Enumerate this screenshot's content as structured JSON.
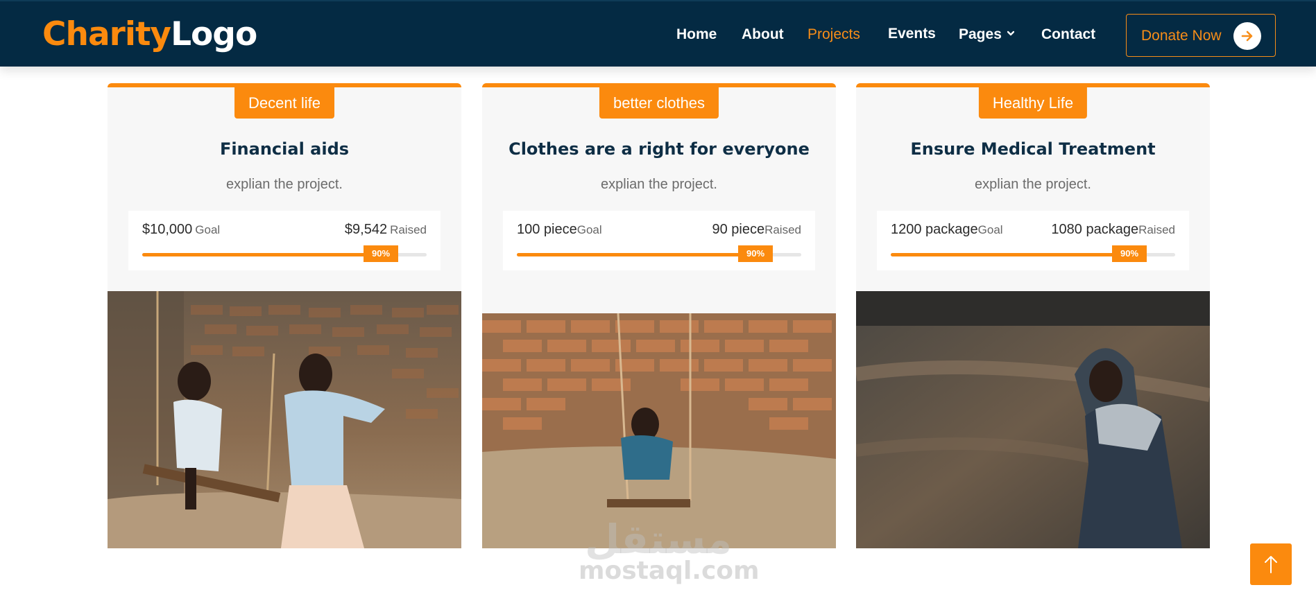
{
  "nav": {
    "logo_part1": "Charity",
    "logo_part2": "Logo",
    "links": [
      {
        "label": "Home"
      },
      {
        "label": "About"
      },
      {
        "label": "Projects"
      },
      {
        "label": "Events"
      },
      {
        "label": "Pages"
      },
      {
        "label": "Contact"
      }
    ],
    "active_link": "Projects",
    "donate_label": "Donate Now"
  },
  "colors": {
    "accent": "#fb8a0e",
    "navbar": "#042a43",
    "title": "#0e2e45",
    "card_bg": "#f7f7f7"
  },
  "projects": [
    {
      "badge": "Decent life",
      "title": "Financial aids",
      "description": "explian the project.",
      "goal_value": "$10,000",
      "goal_label": "Goal",
      "raised_value": "$9,542",
      "raised_label": "Raised",
      "progress_label": "90%",
      "progress": 0.9
    },
    {
      "badge": "better clothes",
      "title": "Clothes are a right for everyone",
      "description": "explian the project.",
      "goal_value": "100 piece",
      "goal_label": "Goal",
      "raised_value": "90 piece",
      "raised_label": "Raised",
      "progress_label": "90%",
      "progress": 0.9
    },
    {
      "badge": "Healthy Life",
      "title": "Ensure Medical Treatment",
      "description": "explian the project.",
      "goal_value": "1200 package",
      "goal_label": "Goal",
      "raised_value": "1080 package",
      "raised_label": "Raised",
      "progress_label": "90%",
      "progress": 0.9
    }
  ],
  "watermark": {
    "arabic": "مستقل",
    "latin": "mostaql.com"
  },
  "icons": {
    "donate": "arrow-right-icon",
    "pages_dropdown": "chevron-down-icon",
    "scroll_top": "arrow-up-icon"
  }
}
